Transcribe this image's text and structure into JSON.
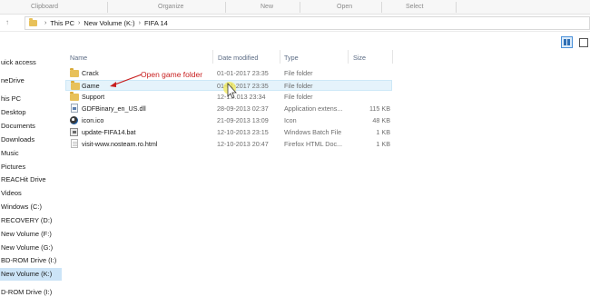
{
  "ribbon": {
    "groups": [
      "Clipboard",
      "Organize",
      "New",
      "Open",
      "Select"
    ]
  },
  "address": {
    "back_icon": "back-arrow-icon",
    "path": [
      "This PC",
      "New Volume (K:)",
      "FIFA 14"
    ]
  },
  "view_toggles": {
    "details_icon": "details-view-icon",
    "tiles_icon": "large-icons-view-icon"
  },
  "nav_pane": {
    "items": [
      {
        "label": "uick access",
        "selected": false
      },
      {
        "label": "neDrive",
        "selected": false
      },
      {
        "label": "his PC",
        "selected": false
      },
      {
        "label": "Desktop",
        "selected": false
      },
      {
        "label": "Documents",
        "selected": false
      },
      {
        "label": "Downloads",
        "selected": false
      },
      {
        "label": "Music",
        "selected": false
      },
      {
        "label": "Pictures",
        "selected": false
      },
      {
        "label": "REACHit Drive",
        "selected": false
      },
      {
        "label": "Videos",
        "selected": false
      },
      {
        "label": "Windows (C:)",
        "selected": false
      },
      {
        "label": "RECOVERY (D:)",
        "selected": false
      },
      {
        "label": "New Volume (F:)",
        "selected": false
      },
      {
        "label": "New Volume (G:)",
        "selected": false
      },
      {
        "label": "BD-ROM Drive (I:)",
        "selected": false
      },
      {
        "label": "New Volume (K:)",
        "selected": true
      },
      {
        "label": "D-ROM Drive (I:)",
        "selected": false
      }
    ]
  },
  "columns": {
    "name": "Name",
    "date": "Date modified",
    "type": "Type",
    "size": "Size"
  },
  "files": [
    {
      "name": "Crack",
      "date": "01-01-2017 23:35",
      "type": "File folder",
      "size": "",
      "icon": "folder-icon"
    },
    {
      "name": "Game",
      "date": "01-01-2017 23:35",
      "type": "File folder",
      "size": "",
      "icon": "folder-icon"
    },
    {
      "name": "Support",
      "date": "12-1…013 23:34",
      "type": "File folder",
      "size": "",
      "icon": "folder-icon"
    },
    {
      "name": "GDFBinary_en_US.dll",
      "date": "28-09-2013 02:37",
      "type": "Application extens...",
      "size": "115 KB",
      "icon": "dll-file-icon"
    },
    {
      "name": "icon.ico",
      "date": "21-09-2013 13:09",
      "type": "Icon",
      "size": "48 KB",
      "icon": "ico-file-icon"
    },
    {
      "name": "update-FIFA14.bat",
      "date": "12-10-2013 23:15",
      "type": "Windows Batch File",
      "size": "1 KB",
      "icon": "batch-file-icon"
    },
    {
      "name": "visit-www.nosteam.ro.html",
      "date": "12-10-2013 20:47",
      "type": "Firefox HTML Doc...",
      "size": "1 KB",
      "icon": "html-file-icon"
    }
  ],
  "annotation": {
    "text": "Open game folder",
    "color": "#c81e1e"
  }
}
